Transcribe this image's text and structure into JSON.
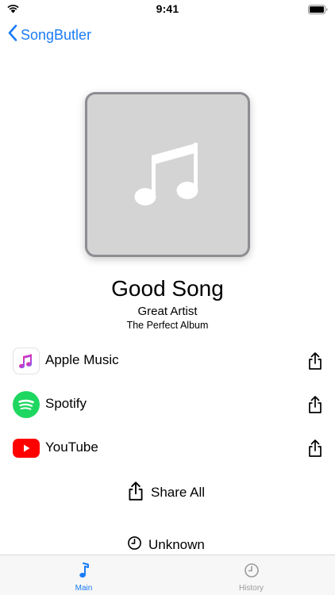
{
  "status_bar": {
    "time": "9:41"
  },
  "nav": {
    "back_label": "SongButler"
  },
  "song": {
    "title": "Good Song",
    "artist": "Great Artist",
    "album": "The Perfect Album"
  },
  "services": [
    {
      "label": "Apple Music",
      "icon": "apple-music-icon"
    },
    {
      "label": "Spotify",
      "icon": "spotify-icon"
    },
    {
      "label": "YouTube",
      "icon": "youtube-icon"
    }
  ],
  "share_all": {
    "label": "Share All",
    "icon": "share-icon"
  },
  "status": {
    "label": "Unknown",
    "icon": "clock-icon"
  },
  "tabs": [
    {
      "label": "Main",
      "icon": "music-note-icon",
      "active": true
    },
    {
      "label": "History",
      "icon": "clock-icon",
      "active": false
    }
  ],
  "colors": {
    "accent": "#1a7cf5",
    "spotify": "#1ed760",
    "youtube": "#ff0000",
    "artwork_bg": "#d4d4d4",
    "artwork_border": "#8d8d92"
  }
}
